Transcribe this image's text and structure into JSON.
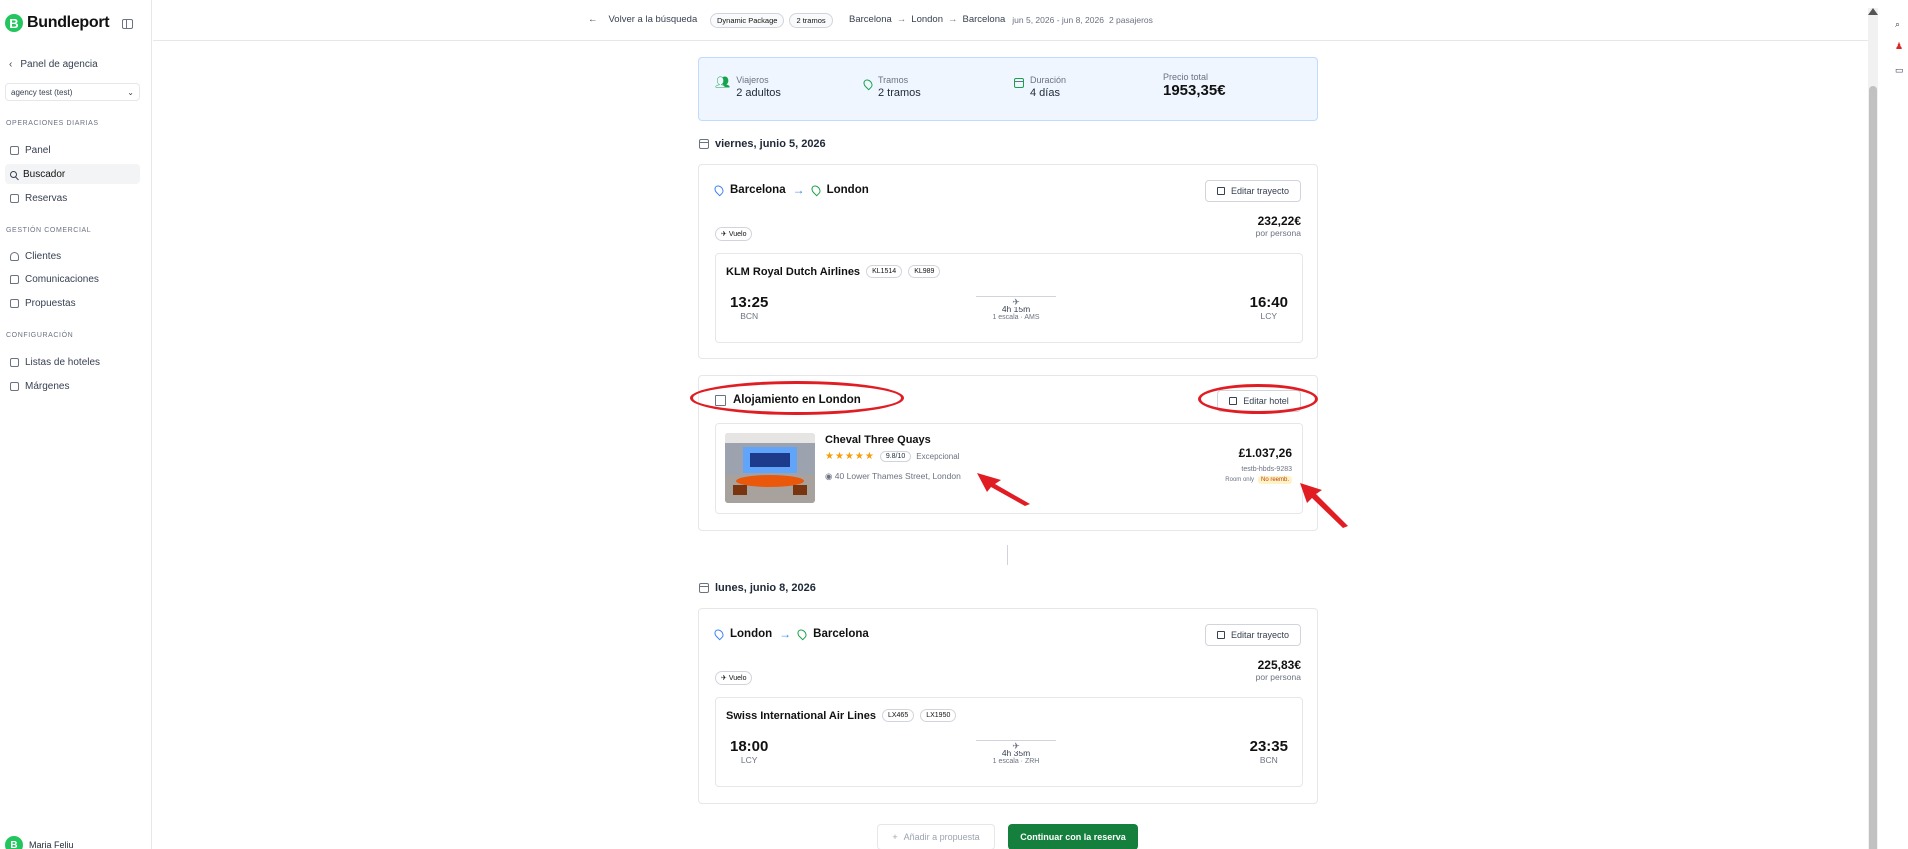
{
  "brand": {
    "name": "Bundleport",
    "logo_letter": "B"
  },
  "sidebar": {
    "back_label": "Panel de agencia",
    "agency": "agency test (test)",
    "sections": [
      {
        "title": "OPERACIONES DIARIAS",
        "items": [
          {
            "label": "Panel"
          },
          {
            "label": "Buscador",
            "active": true
          },
          {
            "label": "Reservas"
          }
        ]
      },
      {
        "title": "GESTIÓN COMERCIAL",
        "items": [
          {
            "label": "Clientes"
          },
          {
            "label": "Comunicaciones"
          },
          {
            "label": "Propuestas"
          }
        ]
      },
      {
        "title": "CONFIGURACIÓN",
        "items": [
          {
            "label": "Listas de hoteles"
          },
          {
            "label": "Márgenes"
          }
        ]
      }
    ],
    "user": {
      "name": "Maria Feliu",
      "initial": "B"
    }
  },
  "topbar": {
    "back_label": "Volver a la búsqueda",
    "package_pill": "Dynamic Package",
    "legs_pill": "2 tramos",
    "route": [
      "Barcelona",
      "London",
      "Barcelona"
    ],
    "dates": "jun 5, 2026 - jun 8, 2026",
    "passengers": "2 pasajeros"
  },
  "summary": {
    "travelers": {
      "label": "Viajeros",
      "value": "2 adultos"
    },
    "legs": {
      "label": "Tramos",
      "value": "2 tramos"
    },
    "duration": {
      "label": "Duración",
      "value": "4 días"
    },
    "total": {
      "label": "Precio total",
      "value": "1953,35€"
    }
  },
  "day1": {
    "date": "viernes, junio 5, 2026",
    "from": "Barcelona",
    "to": "London",
    "edit_label": "Editar trayecto",
    "tag": "Vuelo",
    "price": "232,22€",
    "per_person": "por persona",
    "airline": "KLM Royal Dutch Airlines",
    "codes": [
      "KL1514",
      "KL989"
    ],
    "dep_time": "13:25",
    "dep_airport": "BCN",
    "duration": "4h 15m",
    "stops": "1 escala · AMS",
    "arr_time": "16:40",
    "arr_airport": "LCY"
  },
  "hotel": {
    "title": "Alojamiento en London",
    "edit_label": "Editar hotel",
    "name": "Cheval Three Quays",
    "rating": "9.8/10",
    "rating_text": "Excepcional",
    "address": "40 Lower Thames Street, London",
    "price": "£1.037,26",
    "ref": "testb-hbds-9283",
    "board": "Room only",
    "refund": "No reemb."
  },
  "day2": {
    "date": "lunes, junio 8, 2026",
    "from": "London",
    "to": "Barcelona",
    "edit_label": "Editar trayecto",
    "tag": "Vuelo",
    "price": "225,83€",
    "per_person": "por persona",
    "airline": "Swiss International Air Lines",
    "codes": [
      "LX465",
      "LX1950"
    ],
    "dep_time": "18:00",
    "dep_airport": "LCY",
    "duration": "4h 35m",
    "stops": "1 escala · ZRH",
    "arr_time": "23:35",
    "arr_airport": "BCN"
  },
  "actions": {
    "add_proposal": "Añadir a propuesta",
    "continue": "Continuar con la reserva"
  },
  "colors": {
    "accent": "#15803d",
    "summary_bg": "#eff6ff",
    "annotation": "#e11d24"
  }
}
